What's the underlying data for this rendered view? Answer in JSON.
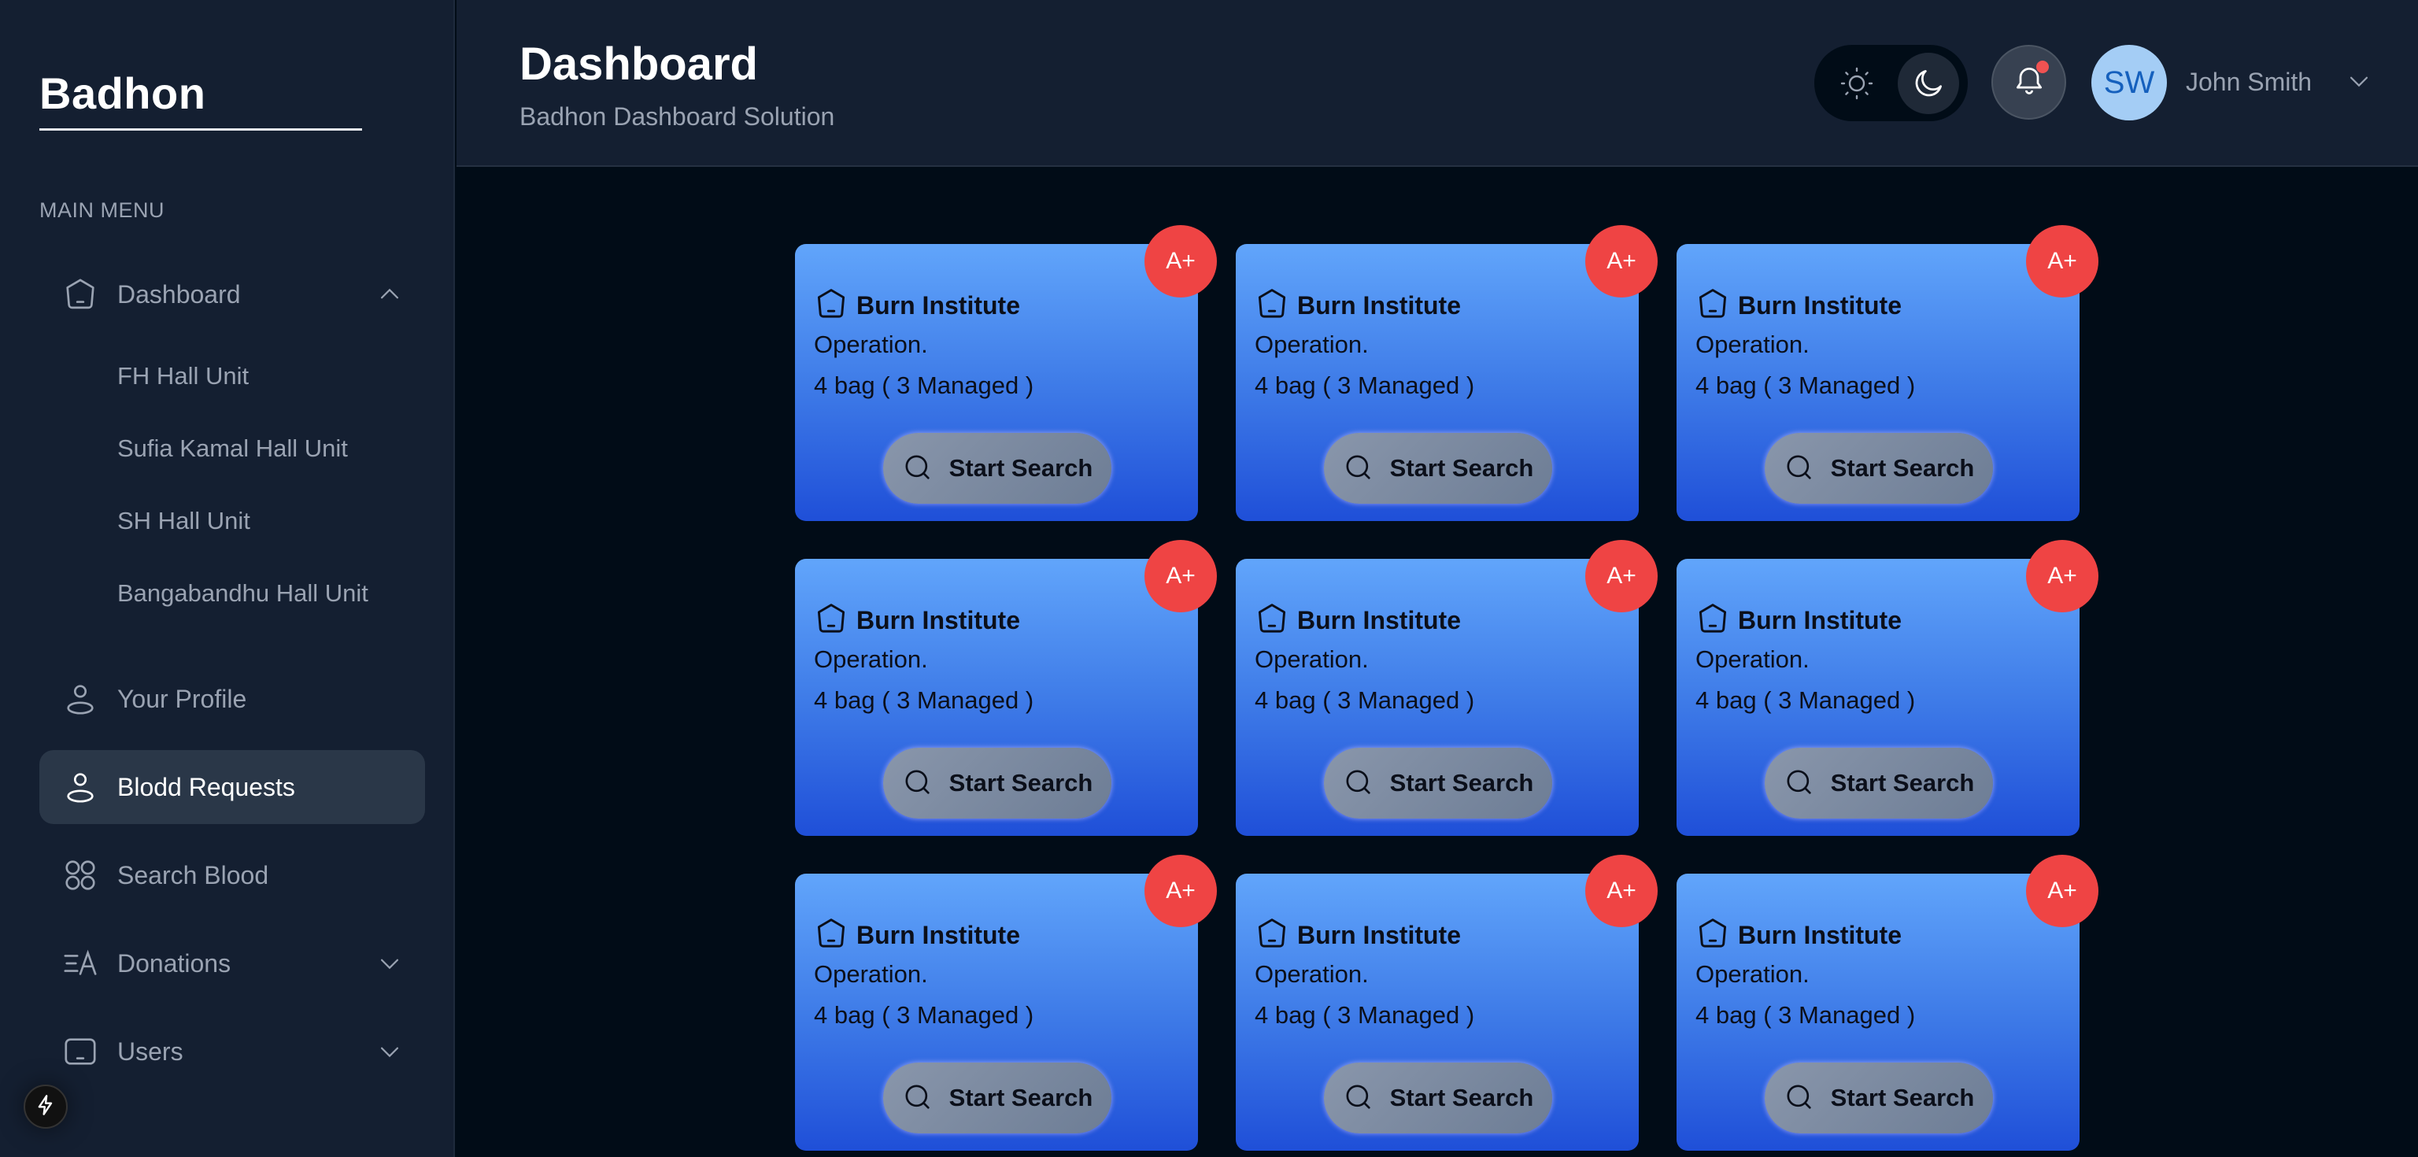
{
  "sidebar": {
    "brand": "Badhon",
    "menu_label": "MAIN MENU",
    "items": [
      {
        "label": "Dashboard",
        "icon": "home-pentagon-icon",
        "expanded": true,
        "children": [
          "FH Hall Unit",
          "Sufia Kamal Hall Unit",
          "SH Hall Unit",
          "Bangabandhu Hall Unit"
        ]
      },
      {
        "label": "Your Profile",
        "icon": "user-icon"
      },
      {
        "label": "Blodd Requests",
        "icon": "user-icon",
        "active": true
      },
      {
        "label": "Search Blood",
        "icon": "grid-circles-icon"
      },
      {
        "label": "Donations",
        "icon": "text-translate-icon",
        "expanded": false
      },
      {
        "label": "Users",
        "icon": "monitor-icon",
        "expanded": false
      }
    ]
  },
  "header": {
    "title": "Dashboard",
    "subtitle": "Badhon Dashboard Solution",
    "theme": "dark",
    "notifications_unread": true,
    "user": {
      "initials": "SW",
      "name": "John Smith"
    }
  },
  "colors": {
    "accent_badge": "#ef4444",
    "card_gradient_top": "#61a5fb",
    "card_gradient_bottom": "#1f4fd8",
    "sidebar_bg": "#141f31",
    "main_bg": "#010c17"
  },
  "cards": [
    {
      "blood_group": "A+",
      "title": "Burn Institute",
      "department": "Operation.",
      "bags": "4 bag ( 3 Managed )",
      "button": "Start Search"
    },
    {
      "blood_group": "A+",
      "title": "Burn Institute",
      "department": "Operation.",
      "bags": "4 bag ( 3 Managed )",
      "button": "Start Search"
    },
    {
      "blood_group": "A+",
      "title": "Burn Institute",
      "department": "Operation.",
      "bags": "4 bag ( 3 Managed )",
      "button": "Start Search"
    },
    {
      "blood_group": "A+",
      "title": "Burn Institute",
      "department": "Operation.",
      "bags": "4 bag ( 3 Managed )",
      "button": "Start Search"
    },
    {
      "blood_group": "A+",
      "title": "Burn Institute",
      "department": "Operation.",
      "bags": "4 bag ( 3 Managed )",
      "button": "Start Search"
    },
    {
      "blood_group": "A+",
      "title": "Burn Institute",
      "department": "Operation.",
      "bags": "4 bag ( 3 Managed )",
      "button": "Start Search"
    },
    {
      "blood_group": "A+",
      "title": "Burn Institute",
      "department": "Operation.",
      "bags": "4 bag ( 3 Managed )",
      "button": "Start Search"
    },
    {
      "blood_group": "A+",
      "title": "Burn Institute",
      "department": "Operation.",
      "bags": "4 bag ( 3 Managed )",
      "button": "Start Search"
    },
    {
      "blood_group": "A+",
      "title": "Burn Institute",
      "department": "Operation.",
      "bags": "4 bag ( 3 Managed )",
      "button": "Start Search"
    }
  ]
}
